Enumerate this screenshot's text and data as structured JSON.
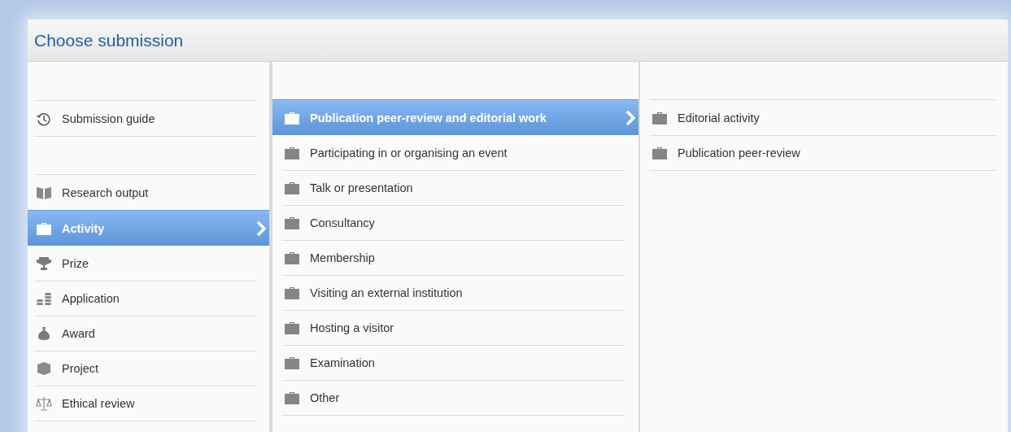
{
  "dialog": {
    "title": "Choose submission"
  },
  "columns": [
    {
      "groups": [
        {
          "items": [
            {
              "label": "Submission guide",
              "kind": "clock",
              "selected": false
            }
          ]
        },
        {
          "items": [
            {
              "label": "Research output",
              "kind": "book",
              "selected": false
            },
            {
              "label": "Activity",
              "kind": "briefcase",
              "selected": true
            },
            {
              "label": "Prize",
              "kind": "trophy",
              "selected": false
            },
            {
              "label": "Application",
              "kind": "coins",
              "selected": false
            },
            {
              "label": "Award",
              "kind": "bag",
              "selected": false
            },
            {
              "label": "Project",
              "kind": "cube",
              "selected": false
            },
            {
              "label": "Ethical review",
              "kind": "scales",
              "selected": false
            }
          ]
        }
      ]
    },
    {
      "groups": [
        {
          "items": [
            {
              "label": "Publication peer-review and editorial work",
              "kind": "briefcase",
              "selected": true
            },
            {
              "label": "Participating in or organising an event",
              "kind": "briefcase",
              "selected": false
            },
            {
              "label": "Talk or presentation",
              "kind": "briefcase",
              "selected": false
            },
            {
              "label": "Consultancy",
              "kind": "briefcase",
              "selected": false
            },
            {
              "label": "Membership",
              "kind": "briefcase",
              "selected": false
            },
            {
              "label": "Visiting an external institution",
              "kind": "briefcase",
              "selected": false
            },
            {
              "label": "Hosting a visitor",
              "kind": "briefcase",
              "selected": false
            },
            {
              "label": "Examination",
              "kind": "briefcase",
              "selected": false
            },
            {
              "label": "Other",
              "kind": "briefcase",
              "selected": false
            }
          ]
        }
      ]
    },
    {
      "groups": [
        {
          "items": [
            {
              "label": "Editorial activity",
              "kind": "briefcase",
              "selected": false
            },
            {
              "label": "Publication peer-review",
              "kind": "briefcase",
              "selected": false
            }
          ]
        }
      ]
    }
  ]
}
